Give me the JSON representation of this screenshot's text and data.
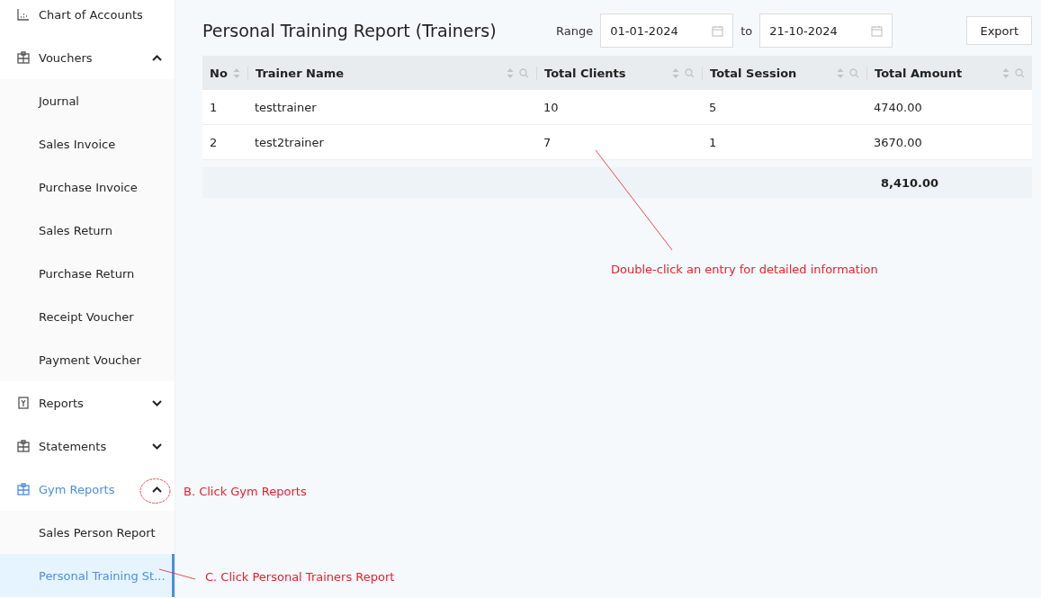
{
  "sidebar": {
    "items": [
      {
        "label": "Chart of Accounts",
        "selected": false
      },
      {
        "label": "Vouchers",
        "expanded": true,
        "selected": false,
        "children": [
          {
            "label": "Journal",
            "selected": false
          },
          {
            "label": "Sales Invoice",
            "selected": false
          },
          {
            "label": "Purchase Invoice",
            "selected": false
          },
          {
            "label": "Sales Return",
            "selected": false
          },
          {
            "label": "Purchase Return",
            "selected": false
          },
          {
            "label": "Receipt Voucher",
            "selected": false
          },
          {
            "label": "Payment Voucher",
            "selected": false
          }
        ]
      },
      {
        "label": "Reports",
        "expanded": false,
        "selected": false
      },
      {
        "label": "Statements",
        "expanded": false,
        "selected": false
      },
      {
        "label": "Gym Reports",
        "expanded": true,
        "selected": true,
        "children": [
          {
            "label": "Sales Person Report",
            "selected": false
          },
          {
            "label": "Personal Training St...",
            "selected": true
          }
        ]
      }
    ]
  },
  "page": {
    "title": "Personal Training Report (Trainers)",
    "range_label": "Range",
    "from": "01-01-2024",
    "to_label": "to",
    "to": "21-10-2024",
    "export": "Export"
  },
  "table": {
    "columns": [
      {
        "label": "No",
        "searchable": false
      },
      {
        "label": "Trainer Name",
        "searchable": true
      },
      {
        "label": "Total Clients",
        "searchable": true
      },
      {
        "label": "Total Session",
        "searchable": true
      },
      {
        "label": "Total Amount",
        "searchable": true
      }
    ],
    "rows": [
      [
        "1",
        "testtrainer",
        "10",
        "5",
        "4740.00"
      ],
      [
        "2",
        "test2trainer",
        "7",
        "1",
        "3670.00"
      ]
    ],
    "total": "8,410.00"
  },
  "annotations": [
    {
      "text": "Double-click an entry for detailed information"
    },
    {
      "text": "B. Click Gym Reports"
    },
    {
      "text": "C. Click Personal Trainers Report"
    }
  ]
}
